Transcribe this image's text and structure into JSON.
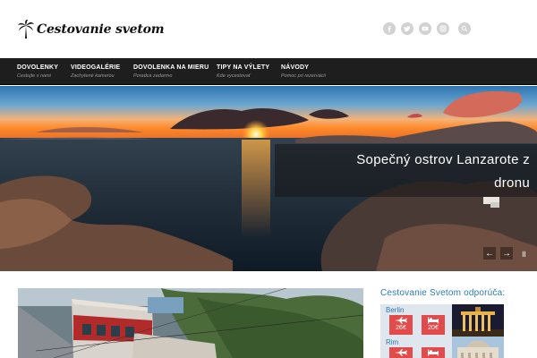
{
  "header": {
    "logo_text": "Cestovanie svetom",
    "social_icons": [
      "facebook-icon",
      "twitter-icon",
      "youtube-icon",
      "instagram-icon",
      "search-icon"
    ]
  },
  "nav": {
    "items": [
      {
        "title": "DOVOLENKY",
        "subtitle": "Cestujte s nami"
      },
      {
        "title": "VIDEOGALÉRIE",
        "subtitle": "Zachytené kamerou"
      },
      {
        "title": "DOVOLENKA NA MIERU",
        "subtitle": "Poradca zadarmo"
      },
      {
        "title": "TIPY NA VÝLETY",
        "subtitle": "Kde vycestovať"
      },
      {
        "title": "NÁVODY",
        "subtitle": "Pomoc pri rezervácii"
      }
    ]
  },
  "slider": {
    "caption_line1": "Sopečný ostrov Lanzarote z",
    "caption_line2": "dronu",
    "prev_label": "←",
    "next_label": "→",
    "pause_label": "॥"
  },
  "sidebar": {
    "title": "Cestovanie Svetom odporúča:",
    "offers": [
      {
        "city": "Berlin",
        "flight_price": "26€",
        "hotel_price": "20€"
      },
      {
        "city": "Rim",
        "flight_price": "",
        "hotel_price": ""
      }
    ]
  },
  "colors": {
    "nav_background": "#1e1e1e",
    "accent_blue": "#2c7ab4",
    "badge_red": "#e24b4b",
    "offer_background": "#dfe6ee"
  }
}
